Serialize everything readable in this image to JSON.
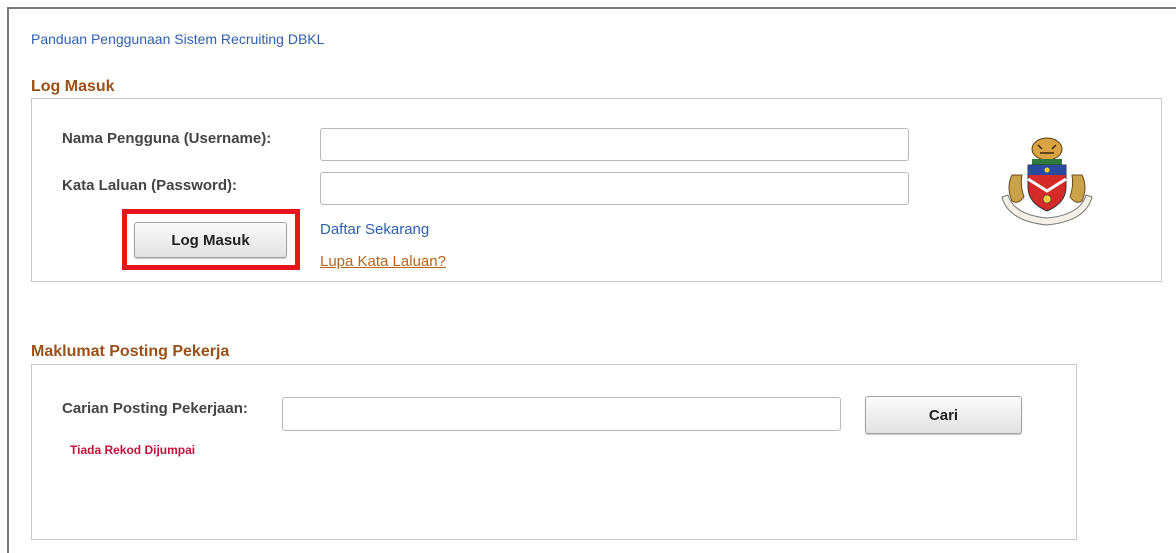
{
  "guide_link": "Panduan Penggunaan Sistem Recruiting DBKL",
  "login": {
    "title": "Log Masuk",
    "username_label": "Nama Pengguna (Username):",
    "username_value": "",
    "password_label": "Kata Laluan (Password):",
    "password_value": "",
    "login_button": "Log Masuk",
    "register_link": "Daftar Sekarang",
    "forgot_link": "Lupa Kata Laluan?",
    "logo_icon": "dbkl-crest-icon"
  },
  "jobs": {
    "title": "Maklumat Posting Pekerja",
    "search_label": "Carian Posting Pekerjaan:",
    "search_value": "",
    "search_button": "Cari",
    "no_record": "Tiada Rekod Dijumpai"
  },
  "colors": {
    "section_title": "#9a5117",
    "link_blue": "#2f5fb0",
    "link_orange": "#b7651b",
    "highlight": "#e8141b",
    "no_record": "#c3113c"
  }
}
